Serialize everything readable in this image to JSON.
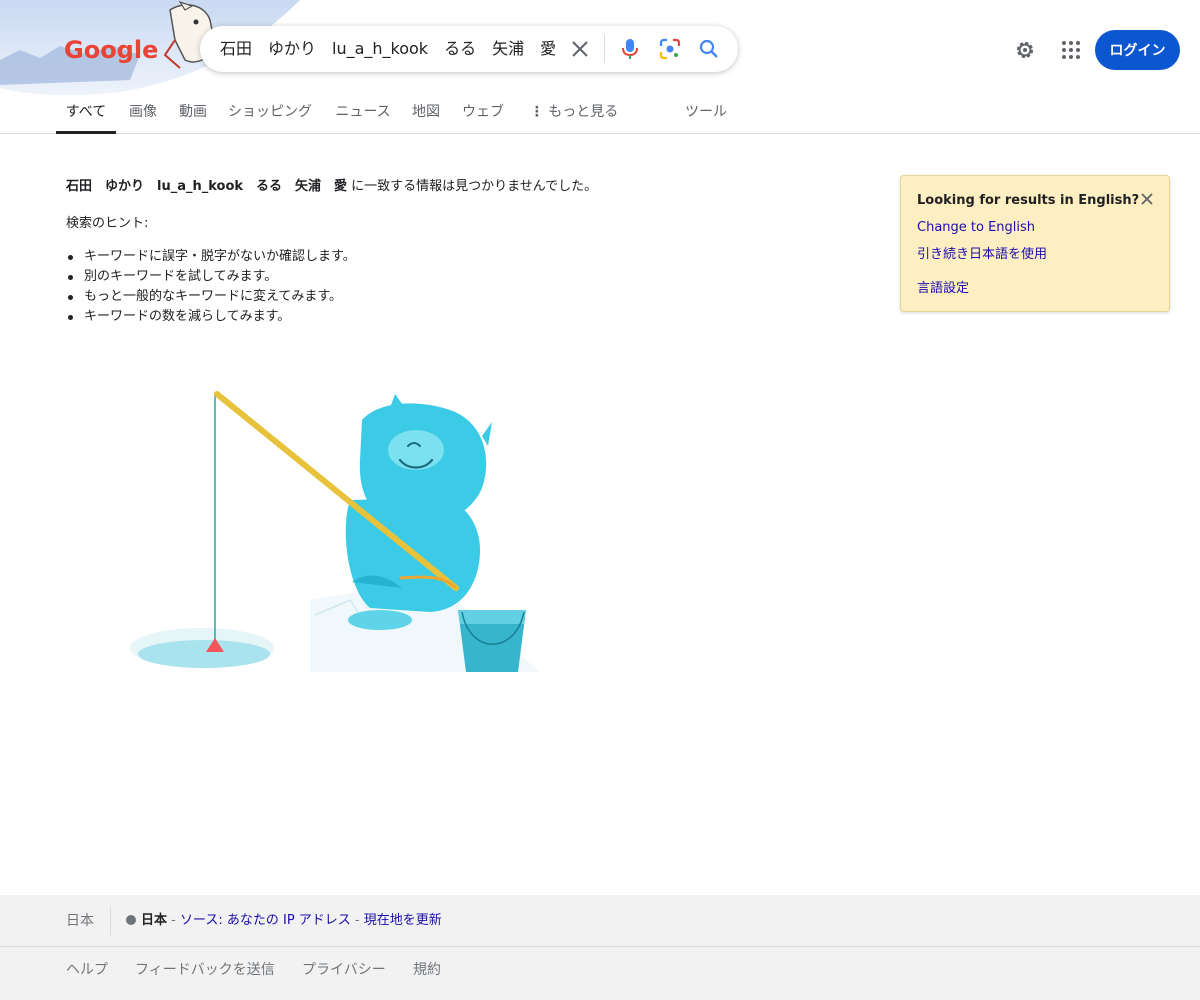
{
  "header": {
    "search_query": "石田　ゆかり　lu_a_h_kook　るる　矢浦　愛",
    "logo_text": "Google",
    "login_label": "ログイン",
    "icons": {
      "clear": "close-icon",
      "voice": "microphone-icon",
      "lens": "camera-lens-icon",
      "search": "search-icon",
      "settings": "gear-icon",
      "apps": "apps-grid-icon"
    }
  },
  "tabs": [
    {
      "label": "すべて",
      "active": true
    },
    {
      "label": "画像"
    },
    {
      "label": "動画"
    },
    {
      "label": "ショッピング"
    },
    {
      "label": "ニュース"
    },
    {
      "label": "地図"
    },
    {
      "label": "ウェブ"
    },
    {
      "label": "もっと見る"
    },
    {
      "label": "ツール"
    }
  ],
  "main": {
    "no_results_query": "石田　ゆかり　lu_a_h_kook　るる　矢浦　愛",
    "no_results_suffix": " に一致する情報は見つかりませんでした。",
    "hint_title": "検索のヒント:",
    "hints": [
      "キーワードに誤字・脱字がないか確認します。",
      "別のキーワードを試してみます。",
      "もっと一般的なキーワードに変えてみます。",
      "キーワードの数を減らしてみます。"
    ]
  },
  "language_box": {
    "title": "Looking for results in English?",
    "change": "Change to English",
    "keep": "引き続き日本語を使用",
    "settings": "言語設定"
  },
  "footer": {
    "country": "日本",
    "location_bold": "日本",
    "location_sep1": " - ",
    "location_source": "ソース: あなたの IP アドレス",
    "location_sep2": " - ",
    "location_update": "現在地を更新",
    "links": [
      "ヘルプ",
      "フィードバックを送信",
      "プライバシー",
      "規約"
    ]
  },
  "colors": {
    "accent": "#0b57d0",
    "link": "#1a0dab",
    "banner_bg": "#feefc3",
    "footer_bg": "#f2f2f2"
  }
}
